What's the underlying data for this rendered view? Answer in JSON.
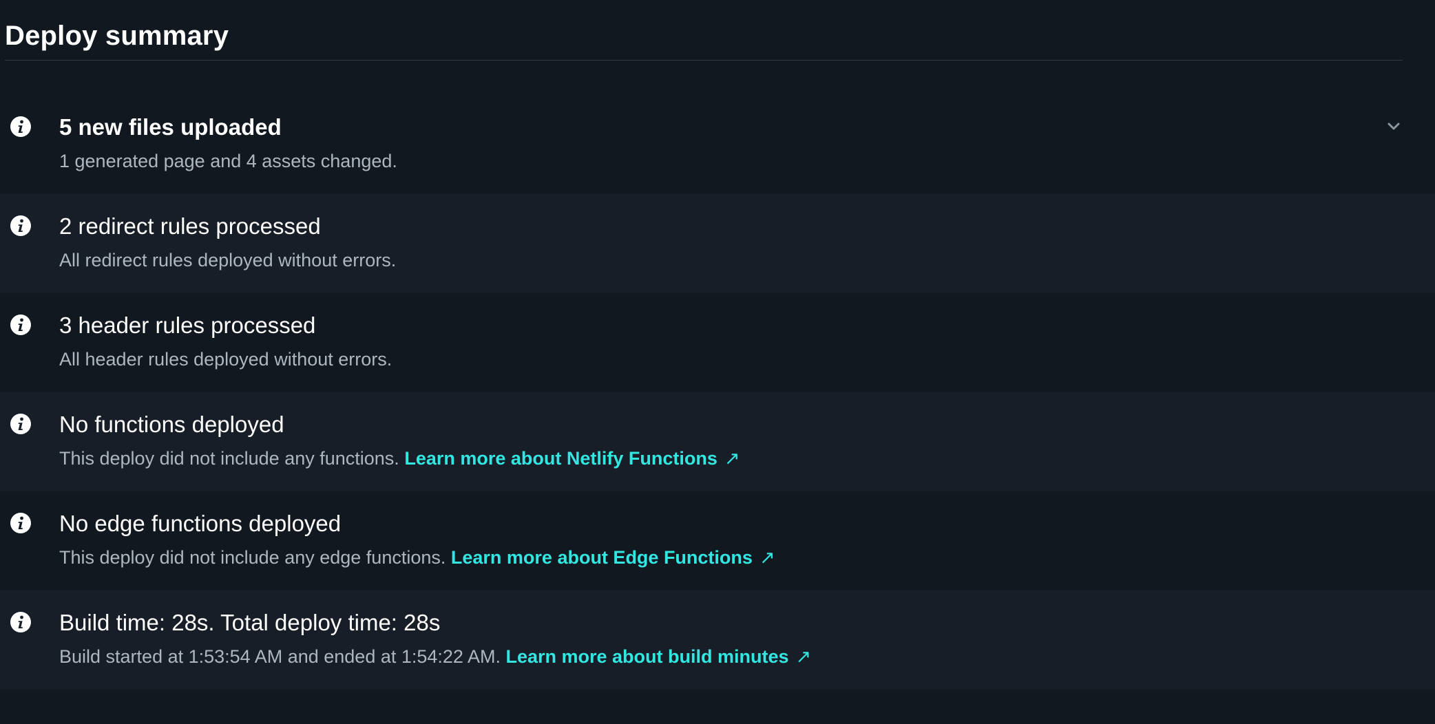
{
  "header": {
    "title": "Deploy summary"
  },
  "items": [
    {
      "title": "5 new files uploaded",
      "description": "1 generated page and 4 assets changed.",
      "icon": "info-icon"
    },
    {
      "title": "2 redirect rules processed",
      "description": "All redirect rules deployed without errors.",
      "icon": "info-icon"
    },
    {
      "title": "3 header rules processed",
      "description": "All header rules deployed without errors.",
      "icon": "info-icon"
    },
    {
      "title": "No functions deployed",
      "description": "This deploy did not include any functions.",
      "link": "Learn more about Netlify Functions",
      "link_arrow": "↗",
      "icon": "info-icon"
    },
    {
      "title": "No edge functions deployed",
      "description": "This deploy did not include any edge functions.",
      "link": "Learn more about Edge Functions",
      "link_arrow": "↗",
      "icon": "info-icon"
    },
    {
      "title": "Build time: 28s. Total deploy time: 28s",
      "description": "Build started at 1:53:54 AM and ended at 1:54:22 AM.",
      "link": "Learn more about build minutes",
      "link_arrow": "↗",
      "icon": "info-icon"
    }
  ],
  "colors": {
    "background": "#121820",
    "row_alt": "#171e27",
    "text": "#ffffff",
    "muted_text": "#aeb6c0",
    "link": "#32e6e2",
    "divider": "#313b47"
  }
}
